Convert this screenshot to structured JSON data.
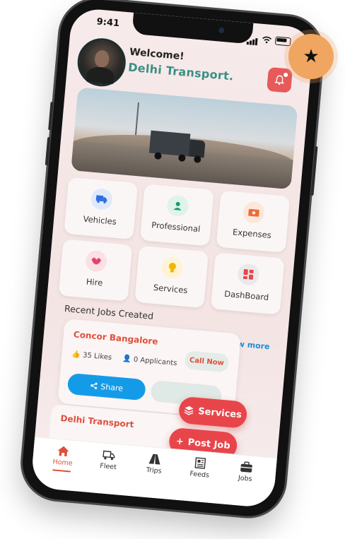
{
  "status": {
    "time": "9:41"
  },
  "header": {
    "greeting": "Welcome!",
    "company": "Delhi Transport."
  },
  "tiles": [
    {
      "label": "Vehicles",
      "icon": "truck-icon",
      "color": "#dfe9fb"
    },
    {
      "label": "Professional",
      "icon": "person-icon",
      "color": "#dff3ec"
    },
    {
      "label": "Expenses",
      "icon": "money-icon",
      "color": "#fde7da"
    },
    {
      "label": "Hire",
      "icon": "handshake-icon",
      "color": "#fbe0e6"
    },
    {
      "label": "Services",
      "icon": "bulb-icon",
      "color": "#fdf4d4"
    },
    {
      "label": "DashBoard",
      "icon": "dashboard-icon",
      "color": "#e9e9e9"
    }
  ],
  "recent": {
    "title": "Recent Jobs Created",
    "view_more": "view more"
  },
  "job": {
    "title": "Concor Bangalore",
    "likes": "35 Likes",
    "applicants": "0 Applicants",
    "call": "Call Now",
    "share": "Share"
  },
  "job2": {
    "title": "Delhi Transport"
  },
  "fab": {
    "services": "Services",
    "post_job": "Post Job"
  },
  "tabs": [
    {
      "label": "Home",
      "icon": "home-icon"
    },
    {
      "label": "Fleet",
      "icon": "fleet-icon"
    },
    {
      "label": "Trips",
      "icon": "trips-icon"
    },
    {
      "label": "Feeds",
      "icon": "feeds-icon"
    },
    {
      "label": "Jobs",
      "icon": "jobs-icon"
    }
  ],
  "colors": {
    "accent": "#e8454b",
    "teal": "#3a8f85",
    "blue": "#149be8"
  }
}
